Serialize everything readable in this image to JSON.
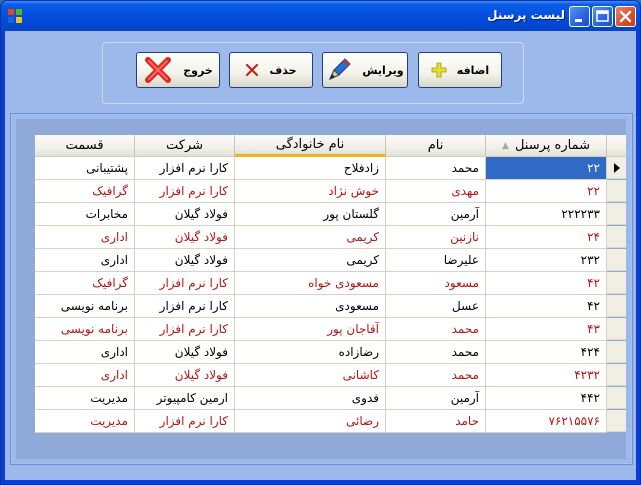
{
  "window": {
    "title": "لیست پرسنل",
    "app_icon": "windows-flag-icon"
  },
  "toolbar": {
    "add_label": "اضافه",
    "edit_label": "ویرایش",
    "delete_label": "حذف",
    "exit_label": "خروج",
    "icons": {
      "add": "plus-icon",
      "edit": "pen-icon",
      "delete": "x-icon",
      "exit": "big-x-icon"
    }
  },
  "grid": {
    "columns": [
      "شماره پرسنل",
      "نام",
      "نام خانوادگی",
      "شرکت",
      "قسمت"
    ],
    "sorted_column": "نام خانوادگی",
    "selected_row": 0,
    "colors": {
      "selection": "#316ac5",
      "alt_text": "#b51515",
      "sort_accent": "#f0b21e"
    },
    "rows": [
      [
        "۲۲",
        "محمد",
        "زادفلاح",
        "کارا نرم افزار",
        "پشتیبانی"
      ],
      [
        "۲۲",
        "مهدی",
        "خوش نژاد",
        "کارا نرم افزار",
        "گرافیک"
      ],
      [
        "۲۲۲۲۳۳",
        "آرمین",
        "گلستان پور",
        "فولاد گیلان",
        "مخابرات"
      ],
      [
        "۲۴",
        "نازنین",
        "کریمی",
        "فولاد گیلان",
        "اداری"
      ],
      [
        "۲۳۲",
        "علیرضا",
        "کریمی",
        "فولاد گیلان",
        "اداری"
      ],
      [
        "۴۲",
        "مسعود",
        "مسعودی خواه",
        "کارا نرم افزار",
        "گرافیک"
      ],
      [
        "۴۲",
        "عسل",
        "مسعودی",
        "کارا نرم افزار",
        "برنامه نویسی"
      ],
      [
        "۴۳",
        "محمد",
        "آقاجان پور",
        "کارا نرم افزار",
        "برنامه نویسی"
      ],
      [
        "۴۲۴",
        "محمد",
        "رضازاده",
        "فولاد گیلان",
        "اداری"
      ],
      [
        "۴۲۳۲",
        "محمد",
        "کاشانی",
        "فولاد گیلان",
        "اداری"
      ],
      [
        "۴۴۲",
        "آرمین",
        "فدوی",
        "ارمین کامپیوتر",
        "مدیریت"
      ],
      [
        "۷۶۲۱۵۵۷۶",
        "حامد",
        "رضائی",
        "کارا نرم افزار",
        "مدیریت"
      ]
    ]
  }
}
